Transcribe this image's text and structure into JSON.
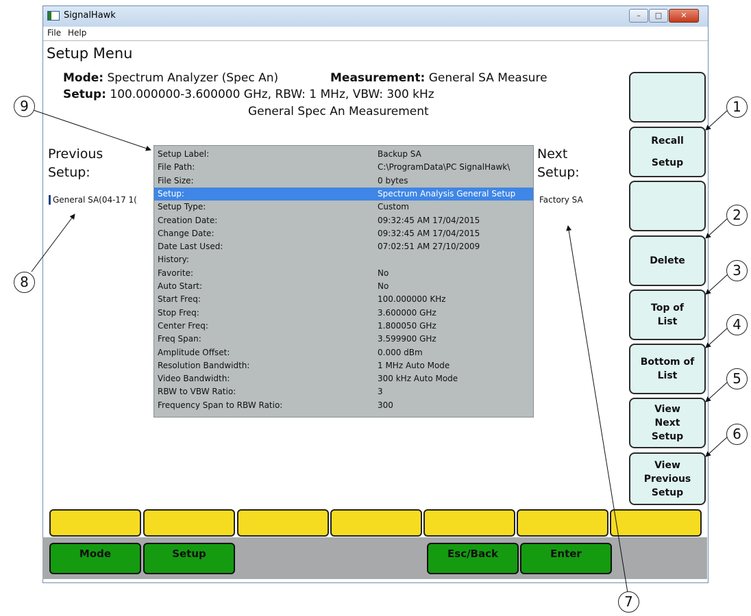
{
  "window": {
    "title": "SignalHawk",
    "buttons": {
      "minimize": "–",
      "maximize": "□",
      "close": "✕"
    }
  },
  "menu": [
    "File",
    "Help"
  ],
  "page_title": "Setup Menu",
  "header": {
    "mode_label": "Mode:",
    "mode_value": "Spectrum Analyzer (Spec An)",
    "measurement_label": "Measurement:",
    "measurement_value": "General SA Measure",
    "setup_label": "Setup:",
    "setup_value": "100.000000-3.600000 GHz, RBW: 1 MHz, VBW: 300 kHz",
    "subtitle": "General Spec An Measurement"
  },
  "previous": {
    "label_line1": "Previous",
    "label_line2": "Setup:",
    "value": "General SA(04-17 1("
  },
  "next": {
    "label_line1": "Next",
    "label_line2": "Setup:",
    "value": "Factory SA"
  },
  "details": [
    {
      "k": "Setup Label:",
      "v": "Backup SA"
    },
    {
      "k": "File Path:",
      "v": "C:\\ProgramData\\PC SignalHawk\\"
    },
    {
      "k": "File Size:",
      "v": "0 bytes"
    },
    {
      "k": "Setup:",
      "v": "Spectrum Analysis General Setup"
    },
    {
      "k": "Setup Type:",
      "v": "Custom"
    },
    {
      "k": "Creation Date:",
      "v": "09:32:45 AM 17/04/2015"
    },
    {
      "k": "Change Date:",
      "v": "09:32:45 AM 17/04/2015"
    },
    {
      "k": "Date Last Used:",
      "v": "07:02:51 AM 27/10/2009"
    },
    {
      "k": "History:",
      "v": ""
    },
    {
      "k": "Favorite:",
      "v": "No"
    },
    {
      "k": "Auto Start:",
      "v": "No"
    },
    {
      "k": "Start Freq:",
      "v": "100.000000 KHz"
    },
    {
      "k": "Stop Freq:",
      "v": "3.600000 GHz"
    },
    {
      "k": "Center Freq:",
      "v": "1.800050 GHz"
    },
    {
      "k": "Freq Span:",
      "v": "3.599900 GHz"
    },
    {
      "k": "Amplitude Offset:",
      "v": "0.000 dBm"
    },
    {
      "k": "Resolution Bandwidth:",
      "v": "1 MHz Auto Mode"
    },
    {
      "k": "Video Bandwidth:",
      "v": "300 kHz Auto Mode"
    },
    {
      "k": "RBW to VBW Ratio:",
      "v": "3"
    },
    {
      "k": "Frequency Span to RBW Ratio:",
      "v": "300"
    }
  ],
  "selected_row": 3,
  "softkeys": {
    "recall": [
      "Recall",
      "Setup"
    ],
    "delete": "Delete",
    "top": [
      "Top of",
      "List"
    ],
    "bottom": [
      "Bottom of",
      "List"
    ],
    "view_next": [
      "View",
      "Next",
      "Setup"
    ],
    "view_prev": [
      "View",
      "Previous",
      "Setup"
    ]
  },
  "bottom_buttons": {
    "mode": "Mode",
    "setup": "Setup",
    "esc": "Esc/Back",
    "enter": "Enter"
  },
  "callouts": [
    "1",
    "2",
    "3",
    "4",
    "5",
    "6",
    "7",
    "8",
    "9"
  ],
  "colors": {
    "selection": "#3f86e6",
    "panel": "#b8bdbd",
    "softkey": "#dff3f1",
    "yellow": "#f6dc20",
    "green": "#149b10"
  }
}
